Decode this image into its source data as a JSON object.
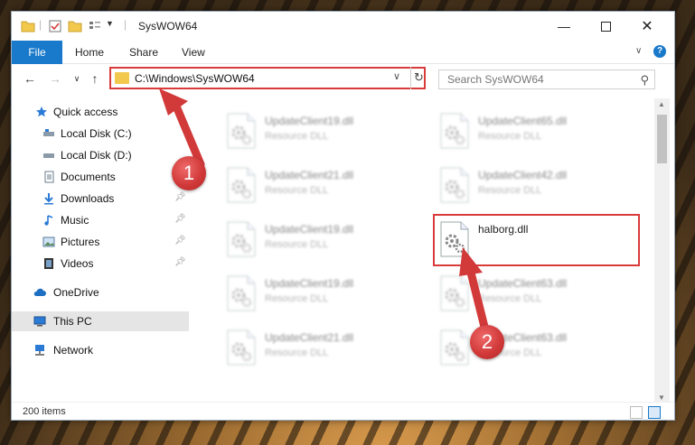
{
  "window": {
    "title": "SysWOW64"
  },
  "ribbon": {
    "tabs": [
      "File",
      "Home",
      "Share",
      "View"
    ]
  },
  "address": {
    "path": "C:\\Windows\\SysWOW64"
  },
  "search": {
    "placeholder": "Search SysWOW64"
  },
  "nav": {
    "items": [
      {
        "label": "Quick access",
        "icon": "star-icon",
        "pinned": false
      },
      {
        "label": "Local Disk (C:)",
        "icon": "drive-icon",
        "pinned": false
      },
      {
        "label": "Local Disk (D:)",
        "icon": "drive-icon",
        "pinned": false
      },
      {
        "label": "Documents",
        "icon": "documents-icon",
        "pinned": false
      },
      {
        "label": "Downloads",
        "icon": "download-arrow-icon",
        "pinned": true
      },
      {
        "label": "Music",
        "icon": "music-note-icon",
        "pinned": true
      },
      {
        "label": "Pictures",
        "icon": "pictures-icon",
        "pinned": true
      },
      {
        "label": "Videos",
        "icon": "film-icon",
        "pinned": true
      },
      {
        "label": "OneDrive",
        "icon": "cloud-icon",
        "pinned": false
      },
      {
        "label": "This PC",
        "icon": "computer-icon",
        "pinned": false
      },
      {
        "label": "Network",
        "icon": "network-icon",
        "pinned": false
      }
    ]
  },
  "files": [
    {
      "name": "UpdateClient19.dll",
      "type": "Resource DLL",
      "blurred": true
    },
    {
      "name": "UpdateClient65.dll",
      "type": "Resource DLL",
      "blurred": true
    },
    {
      "name": "UpdateClient21.dll",
      "type": "Resource DLL",
      "blurred": true
    },
    {
      "name": "UpdateClient42.dll",
      "type": "Resource DLL",
      "blurred": true
    },
    {
      "name": "UpdateClient19.dll",
      "type": "Resource DLL",
      "blurred": true
    },
    {
      "name": "halborg.dll",
      "type": "",
      "blurred": false,
      "highlighted": true
    },
    {
      "name": "UpdateClient19.dll",
      "type": "Resource DLL",
      "blurred": true
    },
    {
      "name": "UpdateClient63.dll",
      "type": "Resource DLL",
      "blurred": true
    },
    {
      "name": "UpdateClient21.dll",
      "type": "Resource DLL",
      "blurred": true
    },
    {
      "name": "UpdateClient63.dll",
      "type": "Resource DLL",
      "blurred": true
    }
  ],
  "status": {
    "items_count": "200 items"
  },
  "callouts": [
    "1",
    "2"
  ],
  "colors": {
    "accent": "#1979ca",
    "highlight_red": "#d93a3a",
    "folder_yellow": "#f2c94c"
  }
}
